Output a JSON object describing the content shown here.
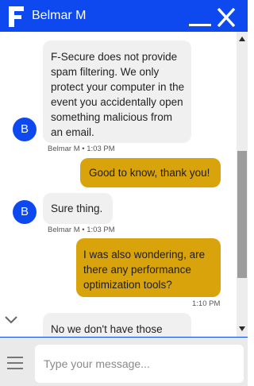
{
  "header": {
    "agent_name": "Belmar M",
    "minimize_icon": "minimize-icon",
    "close_icon": "close-icon",
    "brand_color": "#0d49ee"
  },
  "conversation": {
    "messages": [
      {
        "sender": "agent",
        "avatar_initial": "B",
        "text": "F-Secure does not provide spam filtering. We only protect your computer in the event you accidentally open something malicious from an email.",
        "meta": "Belmar M • 1:03 PM"
      },
      {
        "sender": "user",
        "text": "Good to know, thank you!",
        "meta": ""
      },
      {
        "sender": "agent",
        "avatar_initial": "B",
        "text": "Sure thing.",
        "meta": "Belmar M • 1:03 PM"
      },
      {
        "sender": "user",
        "text": "I was also wondering, are there any performance optimization tools?",
        "meta": "1:10 PM"
      },
      {
        "sender": "agent",
        "text": "No we don't have those",
        "meta": ""
      }
    ],
    "user_bubble_color": "#d9a40b",
    "agent_bubble_color": "#f0f0f0"
  },
  "composer": {
    "placeholder": "Type your message...",
    "menu_icon": "hamburger-menu-icon"
  }
}
